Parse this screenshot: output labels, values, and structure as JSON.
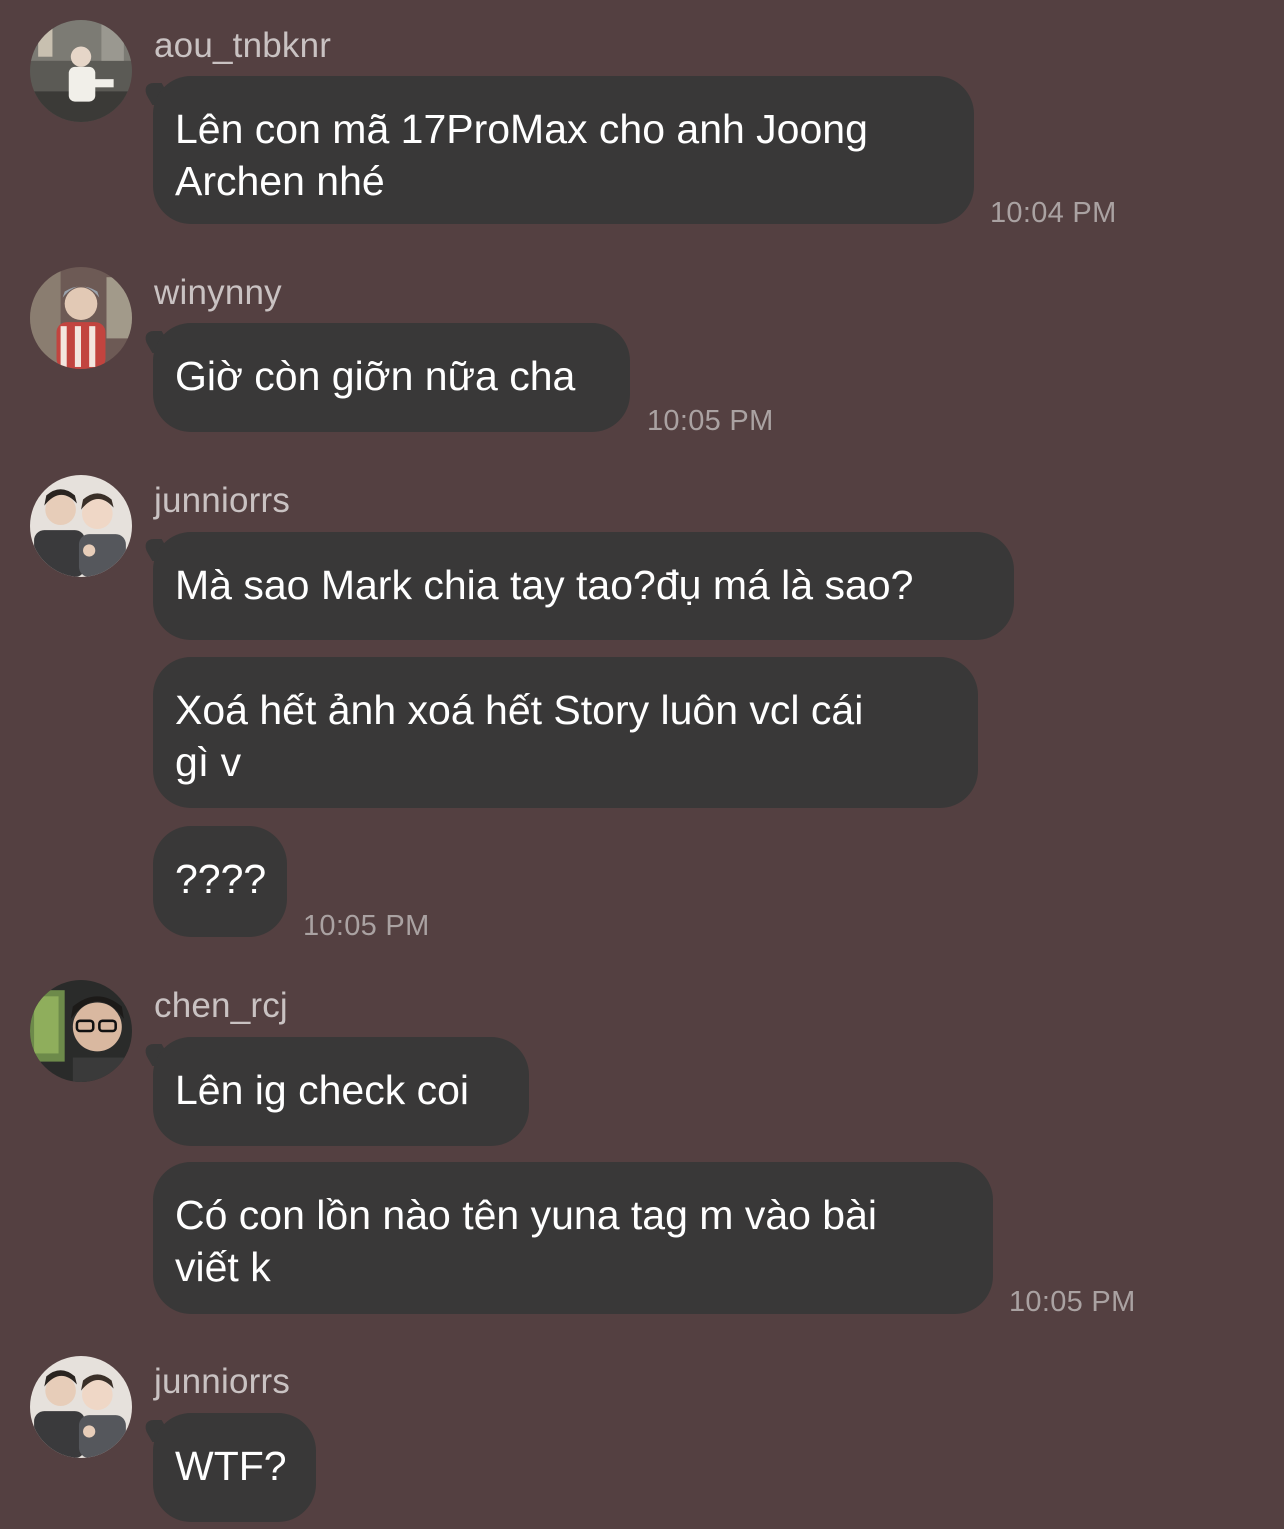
{
  "groups": [
    {
      "sender": "aou_tnbknr",
      "avatar_icon": "user-avatar-photo",
      "messages": [
        "Lên con mã 17ProMax cho anh Joong\nArchen nhé"
      ],
      "time": "10:04 PM"
    },
    {
      "sender": "winynny",
      "avatar_icon": "user-avatar-photo",
      "messages": [
        "Giờ còn giỡn nữa cha"
      ],
      "time": "10:05 PM"
    },
    {
      "sender": "junniorrs",
      "avatar_icon": "user-avatar-photo",
      "messages": [
        "Mà sao Mark chia tay tao?đụ má là sao?",
        "Xoá hết ảnh xoá hết Story luôn vcl cái\ngì v",
        "????"
      ],
      "time": "10:05 PM"
    },
    {
      "sender": "chen_rcj",
      "avatar_icon": "user-avatar-photo",
      "messages": [
        "Lên ig check coi",
        "Có con lồn nào tên yuna tag m vào bài\nviết k"
      ],
      "time": "10:05 PM"
    },
    {
      "sender": "junniorrs",
      "avatar_icon": "user-avatar-photo",
      "messages": [
        "WTF?"
      ]
    }
  ],
  "colors": {
    "background": "#544041",
    "bubble": "#393838",
    "message_text": "#ffffff",
    "sender_text": "#c9c2c2",
    "time_text": "#aaa2a2"
  }
}
